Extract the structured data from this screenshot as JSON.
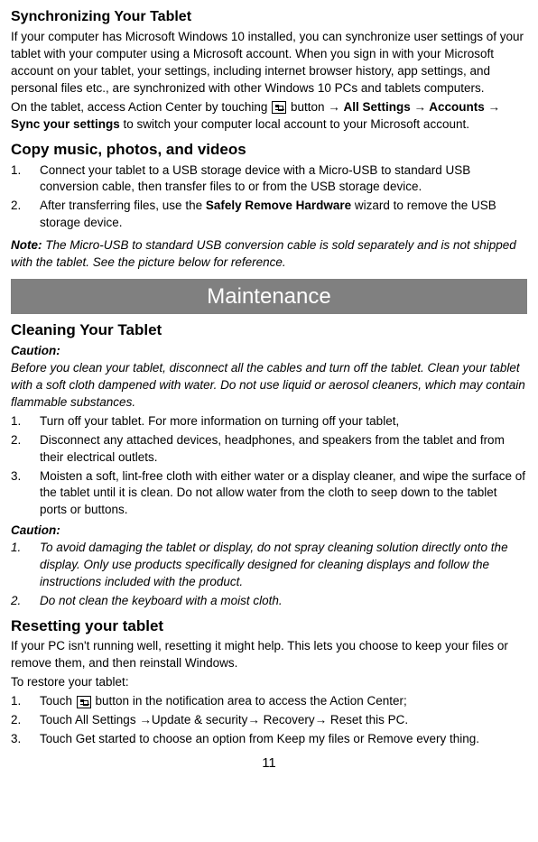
{
  "sync": {
    "heading": "Synchronizing Your Tablet",
    "p1": "If your computer has Microsoft Windows 10 installed, you can synchronize user settings of your tablet with your computer using a Microsoft account. When you sign in with your Microsoft account on your tablet, your settings, including internet browser history, app settings, and personal files etc., are synchronized with other Windows 10 PCs and tablets computers.",
    "p2_a": "On the tablet, access Action Center by touching ",
    "p2_b": " button → ",
    "p2_c": "All Settings → Accounts → Sync your settings",
    "p2_d": " to switch your computer local account to your Microsoft account."
  },
  "copy": {
    "heading": "Copy music, photos, and videos",
    "step1": "Connect your tablet to a USB storage device with a Micro-USB to standard USB conversion cable, then transfer files to or from the USB storage device.",
    "step2_a": "After transferring files, use the ",
    "step2_b": "Safely Remove Hardware",
    "step2_c": " wizard to remove the USB storage device.",
    "note_label": "Note:",
    "note_text": " The Micro-USB to standard USB conversion cable is sold separately and is not shipped with the tablet. See the picture below for reference."
  },
  "banner": "Maintenance",
  "clean": {
    "heading": "Cleaning Your Tablet",
    "caution_label": "Caution:",
    "caution_text": "Before you clean your tablet, disconnect all the cables and turn off the tablet. Clean your tablet with a soft cloth dampened with water. Do not use liquid or aerosol cleaners, which may contain flammable substances.",
    "step1": "Turn off your tablet. For more information on turning off your tablet,",
    "step2": "Disconnect any attached devices, headphones, and speakers from the tablet and from their electrical outlets.",
    "step3": "Moisten a soft, lint-free cloth with either water or a display cleaner, and wipe the surface of the tablet until it is clean. Do not allow water from the cloth to seep down to the tablet ports or buttons.",
    "caution2_label": "Caution:",
    "caution2_step1": "To avoid damaging the tablet or display, do not spray cleaning solution directly onto the display. Only use products specifically designed for cleaning displays and follow the instructions included with the product.",
    "caution2_step2": "Do not clean the keyboard with a moist cloth."
  },
  "reset": {
    "heading": "Resetting your tablet",
    "p1": "If your PC isn't running well, resetting it might help. This lets you choose to keep your files or remove them, and then reinstall Windows.",
    "p2": "To restore your tablet:",
    "step1_a": "Touch ",
    "step1_b": " button in the notification area to access the Action Center;",
    "step2": "Touch All Settings →Update & security→ Recovery→ Reset this PC.",
    "step3": "Touch Get started to choose an option from Keep my files or Remove every thing."
  },
  "page_number": "11"
}
